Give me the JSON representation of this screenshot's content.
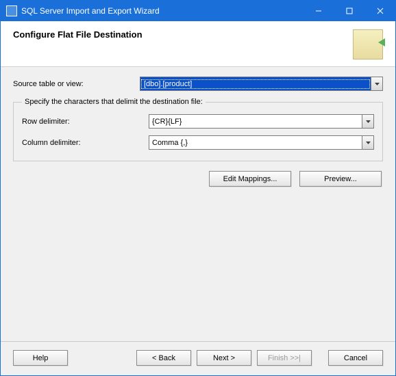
{
  "titlebar": {
    "title": "SQL Server Import and Export Wizard"
  },
  "header": {
    "heading": "Configure Flat File Destination"
  },
  "source": {
    "label": "Source table or view:",
    "value": "[dbo].[product]"
  },
  "fieldset": {
    "legend": "Specify the characters that delimit the destination file:",
    "row_label": "Row delimiter:",
    "row_value": "{CR}{LF}",
    "col_label": "Column delimiter:",
    "col_value": "Comma {,}"
  },
  "actions": {
    "edit_mappings": "Edit Mappings...",
    "preview": "Preview..."
  },
  "footer": {
    "help": "Help",
    "back": "< Back",
    "next": "Next >",
    "finish": "Finish >>|",
    "cancel": "Cancel"
  }
}
